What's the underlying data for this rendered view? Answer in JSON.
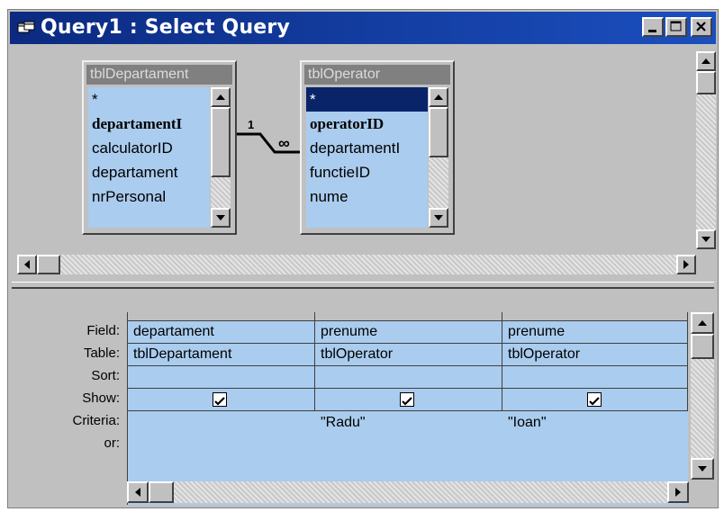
{
  "window": {
    "title": "Query1 : Select Query",
    "titlebar_color": "#0b2a80"
  },
  "tables": [
    {
      "name": "tblDepartament",
      "fields": [
        "*",
        "departamentI",
        "calculatorID",
        "departament",
        "nrPersonal"
      ]
    },
    {
      "name": "tblOperator",
      "fields": [
        "*",
        "operatorID",
        "departamentI",
        "functieID",
        "nume"
      ]
    }
  ],
  "relationship": {
    "one_label": "1",
    "many_label": "∞"
  },
  "grid": {
    "row_labels": {
      "field": "Field:",
      "table": "Table:",
      "sort": "Sort:",
      "show": "Show:",
      "criteria": "Criteria:",
      "or": "or:"
    },
    "columns": [
      {
        "field": "departament",
        "table": "tblDepartament",
        "sort": "",
        "show": true,
        "criteria": ""
      },
      {
        "field": "prenume",
        "table": "tblOperator",
        "sort": "",
        "show": true,
        "criteria": "\"Radu\""
      },
      {
        "field": "prenume",
        "table": "tblOperator",
        "sort": "",
        "show": true,
        "criteria": "\"Ioan\""
      }
    ]
  },
  "colors": {
    "field_list_bg": "#aaccee",
    "grid_bg": "#aaccee",
    "selection": "#0a246a"
  }
}
